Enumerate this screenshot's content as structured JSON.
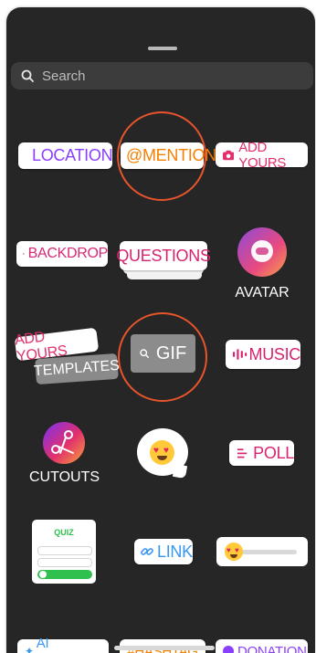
{
  "search": {
    "placeholder": "Search"
  },
  "stickers": {
    "location": "LOCATION",
    "mention": "@MENTION",
    "add_yours": "ADD YOURS",
    "backdrop": "BACKDROP",
    "questions": "QUESTIONS",
    "avatar": "AVATAR",
    "add_yours_templates_top": "ADD YOURS",
    "add_yours_templates_bottom": "TEMPLATES",
    "gif": "GIF",
    "music": "MUSIC",
    "cutouts": "CUTOUTS",
    "poll": "POLL",
    "quiz": "QUIZ",
    "link": "LINK",
    "ai_stickers": "AI STICKERS",
    "hashtag": "#HASHTAG",
    "donation": "DONATION"
  },
  "colors": {
    "background": "#262626",
    "highlight_circle": "#e8542c",
    "location": "#8a3ffc",
    "mention": "#f77f00",
    "add_yours": "#e1306c",
    "backdrop": "#d62976",
    "music": "#d6246e",
    "link": "#3897f0",
    "quiz_green": "#2fc04d"
  }
}
